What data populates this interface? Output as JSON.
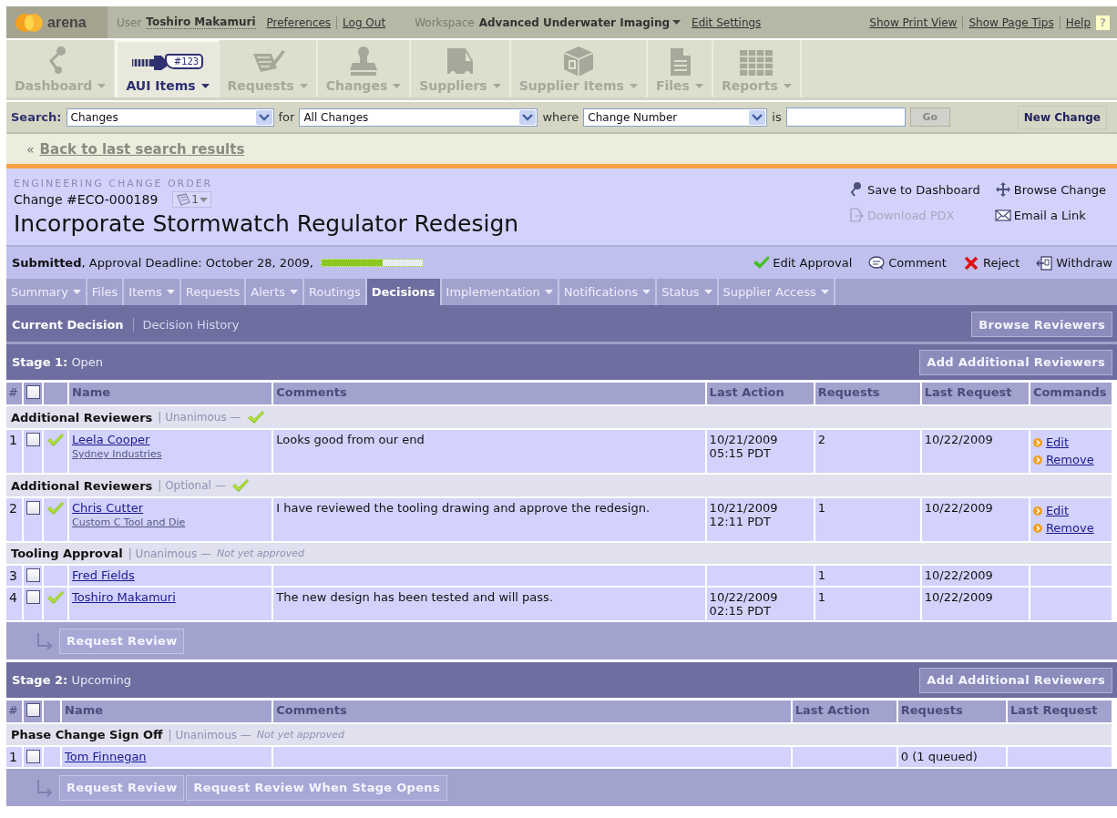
{
  "topbar": {
    "logo": "arena",
    "user_label": "User",
    "user": "Toshiro Makamuri",
    "account_links": [
      "Preferences",
      "Log Out"
    ],
    "workspace_label": "Workspace",
    "workspace": "Advanced Underwater Imaging",
    "edit_settings": "Edit Settings",
    "page_links": [
      "Show Print View",
      "Show Page Tips",
      "Help"
    ],
    "help_badge": "?"
  },
  "nav_tabs": [
    {
      "label": "Dashboard",
      "kind": "dashboard",
      "selected": false
    },
    {
      "label": "AUI Items",
      "kind": "items",
      "badge": "#123",
      "selected": true
    },
    {
      "label": "Requests",
      "kind": "requests",
      "selected": false
    },
    {
      "label": "Changes",
      "kind": "changes",
      "selected": false
    },
    {
      "label": "Suppliers",
      "kind": "suppliers",
      "selected": false
    },
    {
      "label": "Supplier Items",
      "kind": "supplier_items",
      "selected": false
    },
    {
      "label": "Files",
      "kind": "files",
      "selected": false
    },
    {
      "label": "Reports",
      "kind": "reports",
      "selected": false
    }
  ],
  "search": {
    "label": "Search:",
    "type": "Changes",
    "for_label": "for",
    "scope": "All Changes",
    "where_label": "where",
    "attribute": "Change Number",
    "is_label": "is",
    "go_button": "Go",
    "new_button": "New Change"
  },
  "back_link": {
    "arrows": "«",
    "label": "Back to last search results"
  },
  "change": {
    "type": "ENGINEERING CHANGE ORDER",
    "number": "Change #ECO-000189",
    "revision": "1",
    "title": "Incorporate Stormwatch Regulator Redesign",
    "actions": [
      {
        "label": "Save to Dashboard",
        "kind": "pin",
        "disabled": false
      },
      {
        "label": "Browse Change",
        "kind": "browse",
        "disabled": false
      },
      {
        "label": "Download PDX",
        "kind": "download",
        "disabled": true
      },
      {
        "label": "Email a Link",
        "kind": "email",
        "disabled": false
      }
    ]
  },
  "status": {
    "text": "**Submitted**, Approval Deadline: October 28, 2009,",
    "progress": {
      "level": 0.6
    },
    "actions": [
      {
        "label": "Edit Approval",
        "kind": "approve"
      },
      {
        "label": "Comment",
        "kind": "comment"
      },
      {
        "label": "Reject",
        "kind": "reject"
      },
      {
        "label": "Withdraw",
        "kind": "withdraw"
      }
    ]
  },
  "sub_tabs": [
    {
      "label": "Summary",
      "dropdown": true,
      "selected": false
    },
    {
      "label": "Files",
      "dropdown": false,
      "selected": false
    },
    {
      "label": "Items",
      "dropdown": true,
      "selected": false
    },
    {
      "label": "Requests",
      "dropdown": false,
      "selected": false
    },
    {
      "label": "Alerts",
      "dropdown": true,
      "selected": false
    },
    {
      "label": "Routings",
      "dropdown": false,
      "selected": false
    },
    {
      "label": "Decisions",
      "dropdown": false,
      "selected": true
    },
    {
      "label": "Implementation",
      "dropdown": true,
      "selected": false
    },
    {
      "label": "Notifications",
      "dropdown": true,
      "selected": false
    },
    {
      "label": "Status",
      "dropdown": true,
      "selected": false
    },
    {
      "label": "Supplier Access",
      "dropdown": true,
      "selected": false
    }
  ],
  "decision_tabs": [
    {
      "label": "Current Decision",
      "selected": true
    },
    {
      "label": "Decision History",
      "selected": false
    }
  ],
  "browse_reviewers": "Browse Reviewers",
  "stages": [
    {
      "heading": "**Stage 1:** Open",
      "add_button": "Add Additional Reviewers",
      "header_checked": false,
      "columns": [
        "#",
        "Name",
        "Comments",
        "Last Action",
        "Requests",
        "Last Request",
        "Commands"
      ],
      "rows": [
        {
          "kind": "group",
          "name": "Additional Reviewers",
          "rule": "| Unanimous —",
          "approved": true
        },
        {
          "kind": "reviewer",
          "number": "1",
          "checked": false,
          "approved": true,
          "name": "Leela Cooper",
          "company": "Sydney Industries",
          "comment": "Looks good from our end",
          "last_action": "10/21/2009\n05:15 PDT",
          "requests": "2",
          "last_request": "10/22/2009",
          "commands": [
            "Edit",
            "Remove"
          ]
        },
        {
          "kind": "group",
          "name": "Additional Reviewers",
          "rule": "| Optional —",
          "approved": true
        },
        {
          "kind": "reviewer",
          "number": "2",
          "checked": false,
          "approved": true,
          "name": "Chris Cutter",
          "company": "Custom C Tool and Die",
          "comment": "I have reviewed the tooling drawing and approve the redesign.",
          "last_action": "10/21/2009\n12:11 PDT",
          "requests": "1",
          "last_request": "10/22/2009",
          "commands": [
            "Edit",
            "Remove"
          ]
        },
        {
          "kind": "group",
          "name": "Tooling Approval",
          "rule": "| Unanimous —",
          "approved": false,
          "status_note": "Not yet approved"
        },
        {
          "kind": "reviewer",
          "number": "3",
          "checked": false,
          "approved": false,
          "name": "Fred Fields",
          "requests": "1",
          "last_request": "10/22/2009"
        },
        {
          "kind": "reviewer",
          "number": "4",
          "checked": false,
          "approved": true,
          "name": "Toshiro Makamuri",
          "comment": "The new design has been tested and will pass.",
          "last_action": "10/22/2009\n02:15 PDT",
          "requests": "1",
          "last_request": "10/22/2009"
        }
      ],
      "buttons": [
        "Request Review"
      ]
    },
    {
      "heading": "**Stage 2:** Upcoming",
      "add_button": "Add Additional Reviewers",
      "header_checked": false,
      "columns": [
        "#",
        "Name",
        "Comments",
        "Last Action",
        "Requests",
        "Last Request"
      ],
      "rows": [
        {
          "kind": "group",
          "name": "Phase Change Sign Off",
          "rule": "| Unanimous —",
          "approved": false,
          "status_note": "Not yet approved"
        },
        {
          "kind": "reviewer",
          "number": "1",
          "checked": false,
          "approved": false,
          "name": "Tom Finnegan",
          "requests": "0 (1 queued)"
        }
      ],
      "buttons": [
        "Request Review",
        "Request Review When Stage Opens"
      ]
    }
  ]
}
